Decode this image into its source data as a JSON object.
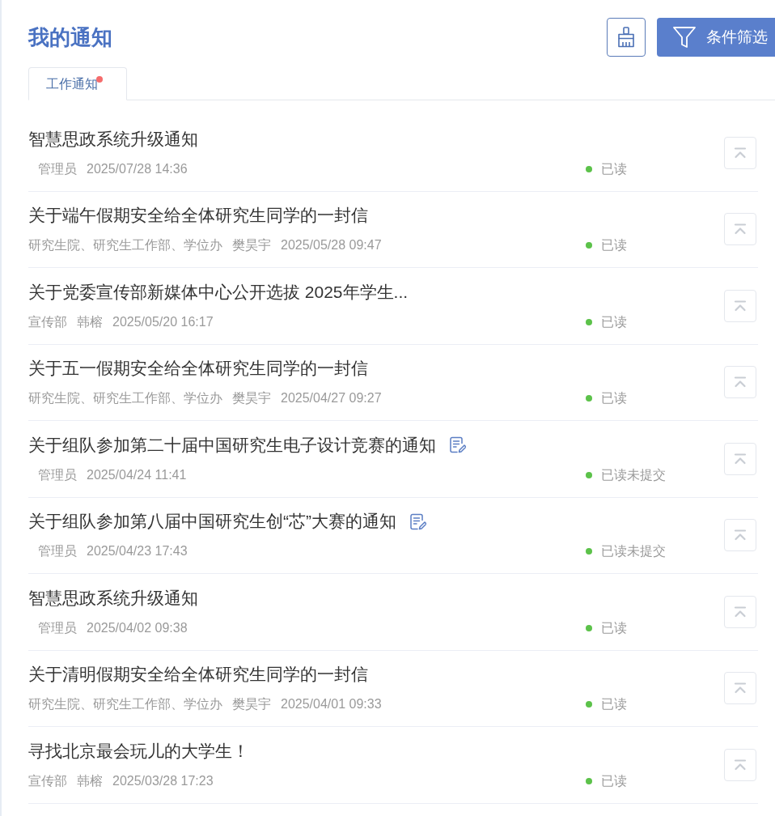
{
  "header": {
    "title": "我的通知",
    "filter_label": "条件筛选"
  },
  "tabs": [
    {
      "label": "工作通知",
      "selected": true,
      "unread_dot": true
    }
  ],
  "notices": [
    {
      "title": "智慧思政系统升级通知",
      "author": "管理员",
      "time": "2025/07/28 14:36",
      "status": "已读",
      "has_form": false
    },
    {
      "title": "关于端午假期安全给全体研究生同学的一封信",
      "department": "研究生院、研究生工作部、学位办",
      "author": "樊昊宇",
      "time": "2025/05/28 09:47",
      "status": "已读",
      "has_form": false
    },
    {
      "title": "关于党委宣传部新媒体中心公开选拔 2025年学生...",
      "department": "宣传部",
      "author": "韩榕",
      "time": "2025/05/20 16:17",
      "status": "已读",
      "has_form": false
    },
    {
      "title": "关于五一假期安全给全体研究生同学的一封信",
      "department": "研究生院、研究生工作部、学位办",
      "author": "樊昊宇",
      "time": "2025/04/27 09:27",
      "status": "已读",
      "has_form": false
    },
    {
      "title": "关于组队参加第二十届中国研究生电子设计竞赛的通知",
      "author": "管理员",
      "time": "2025/04/24 11:41",
      "status": "已读未提交",
      "has_form": true
    },
    {
      "title": "关于组队参加第八届中国研究生创“芯”大赛的通知",
      "author": "管理员",
      "time": "2025/04/23 17:43",
      "status": "已读未提交",
      "has_form": true
    },
    {
      "title": "智慧思政系统升级通知",
      "author": "管理员",
      "time": "2025/04/02 09:38",
      "status": "已读",
      "has_form": false
    },
    {
      "title": "关于清明假期安全给全体研究生同学的一封信",
      "department": "研究生院、研究生工作部、学位办",
      "author": "樊昊宇",
      "time": "2025/04/01 09:33",
      "status": "已读",
      "has_form": false
    },
    {
      "title": "寻找北京最会玩儿的大学生！",
      "department": "宣传部",
      "author": "韩榕",
      "time": "2025/03/28 17:23",
      "status": "已读",
      "has_form": false
    }
  ]
}
